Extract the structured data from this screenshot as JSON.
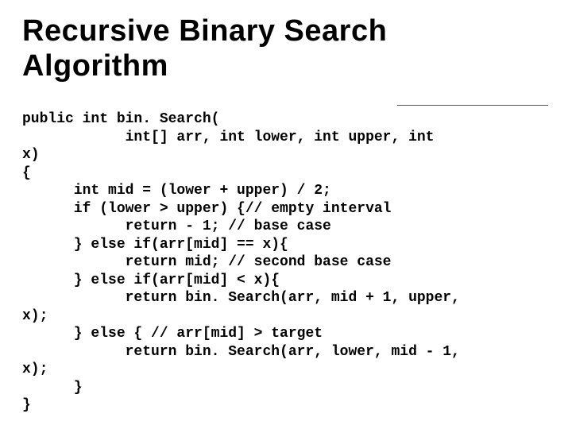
{
  "title_line1": "Recursive Binary Search",
  "title_line2": "Algorithm",
  "code": {
    "l1": "public int bin. Search(",
    "l2": "            int[] arr, int lower, int upper, int",
    "l3": "x)",
    "l4": "{",
    "l5": "      int mid = (lower + upper) / 2;",
    "l6": "      if (lower > upper) {// empty interval",
    "l7": "            return - 1; // base case",
    "l8": "      } else if(arr[mid] == x){",
    "l9": "            return mid; // second base case",
    "l10": "      } else if(arr[mid] < x){",
    "l11": "            return bin. Search(arr, mid + 1, upper,",
    "l12": "x);",
    "l13": "      } else { // arr[mid] > target",
    "l14": "            return bin. Search(arr, lower, mid - 1,",
    "l15": "x);",
    "l16": "      }",
    "l17": "}"
  }
}
